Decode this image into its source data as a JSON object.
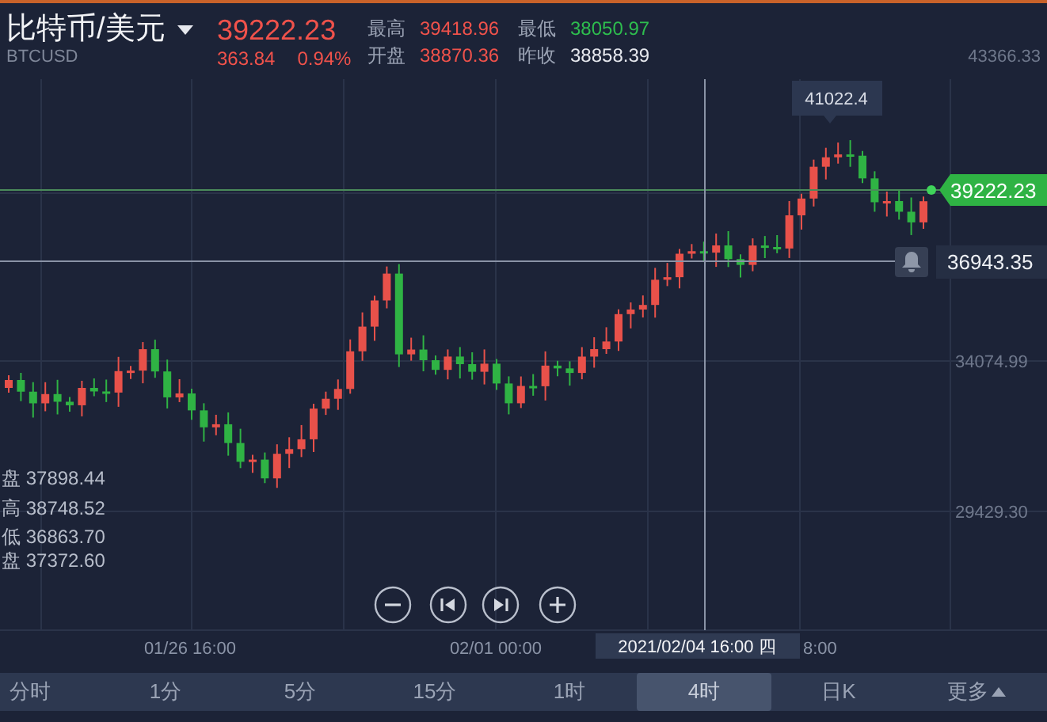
{
  "header": {
    "title": "比特币/美元",
    "symbol": "BTCUSD",
    "price": "39222.23",
    "change": "363.84",
    "change_pct": "0.94%",
    "stats": [
      {
        "label": "最高",
        "value": "39418.96",
        "color": "#f0524b"
      },
      {
        "label": "开盘",
        "value": "38870.36",
        "color": "#f0524b"
      },
      {
        "label": "最低",
        "value": "38050.97",
        "color": "#2ebd4e"
      },
      {
        "label": "昨收",
        "value": "38858.39",
        "color": "#e6e8ee"
      }
    ]
  },
  "chart": {
    "y_axis": [
      "43366.33",
      "34074.99",
      "29429.30"
    ],
    "x_axis": [
      "01/26 16:00",
      "02/01 00:00",
      "8:00"
    ],
    "tooltip": "41022.4",
    "current_price": "39222.23",
    "crosshair_price": "36943.35",
    "crosshair_time": "2021/02/04 16:00 四",
    "ohlc": [
      {
        "label": "盘",
        "value": "37898.44"
      },
      {
        "label": "高",
        "value": "38748.52"
      },
      {
        "label": "低",
        "value": "36863.70"
      },
      {
        "label": "盘",
        "value": "37372.60"
      }
    ]
  },
  "tabs": [
    {
      "label": "分时",
      "selected": false,
      "kind": "tab"
    },
    {
      "label": "1分",
      "selected": false,
      "kind": "tab"
    },
    {
      "label": "5分",
      "selected": false,
      "kind": "tab"
    },
    {
      "label": "15分",
      "selected": false,
      "kind": "tab"
    },
    {
      "label": "1时",
      "selected": false,
      "kind": "tab"
    },
    {
      "label": "4时",
      "selected": true,
      "kind": "tab"
    },
    {
      "label": "日K",
      "selected": false,
      "kind": "tab"
    },
    {
      "label": "更多",
      "selected": false,
      "kind": "menu"
    }
  ]
}
